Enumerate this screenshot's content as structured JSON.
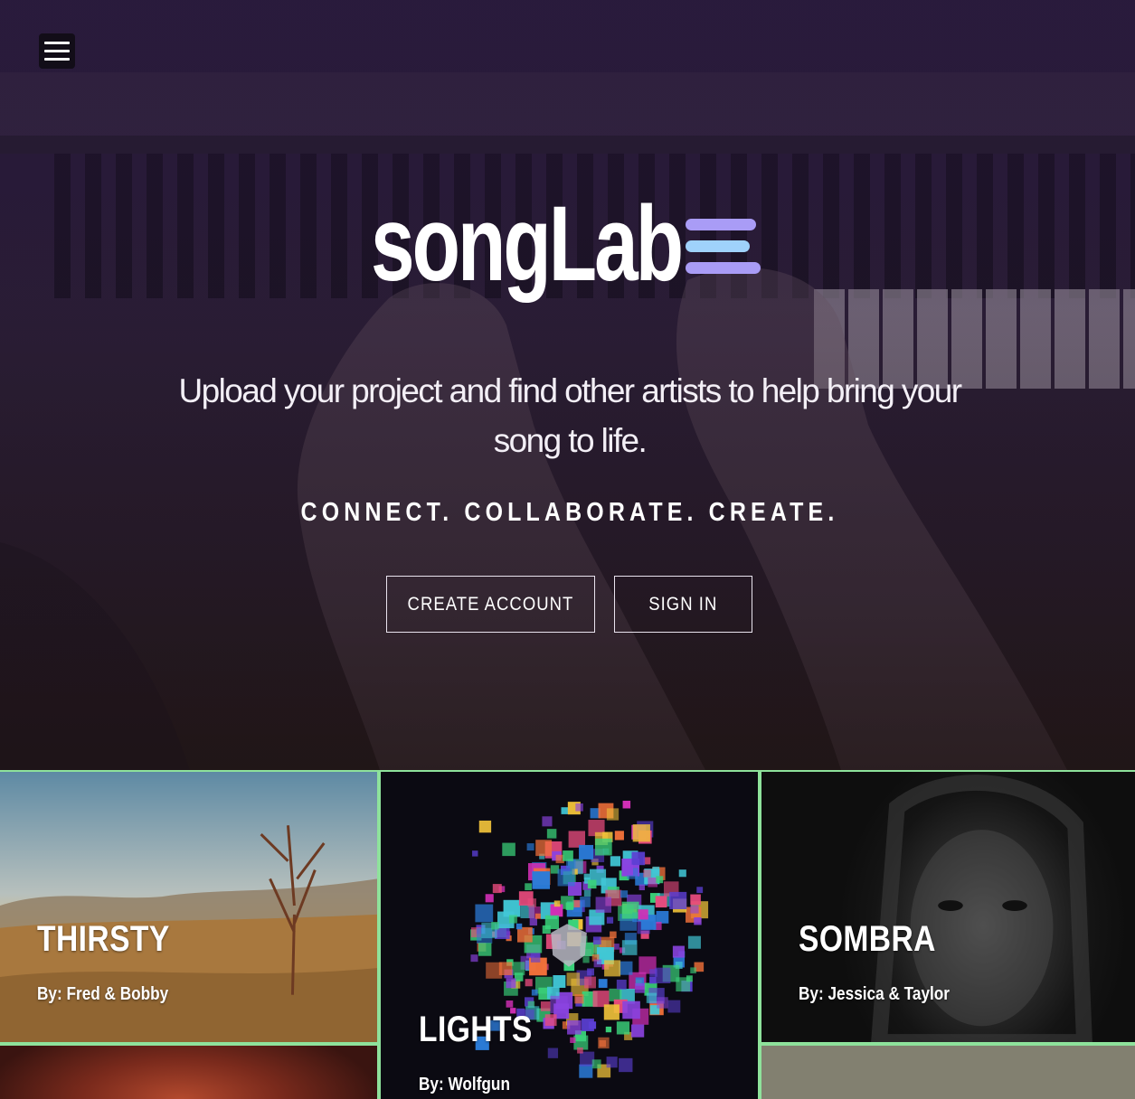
{
  "header": {
    "menu_icon": "hamburger-menu-icon"
  },
  "hero": {
    "logo_text": "songLab",
    "logo_mark_icon": "three-bars-logo-icon",
    "tagline": "Upload your project and find other artists to help bring your song to life.",
    "slogan": "CONNECT. COLLABORATE. CREATE.",
    "create_account_label": "CREATE ACCOUNT",
    "sign_in_label": "SIGN IN"
  },
  "projects": [
    {
      "title": "THIRSTY",
      "by": "By: Fred & Bobby"
    },
    {
      "title": "LIGHTS",
      "by": "By: Wolfgun"
    },
    {
      "title": "SOMBRA",
      "by": "By: Jessica & Taylor"
    }
  ],
  "colors": {
    "accent_purple": "#a99cf6",
    "accent_blue": "#9fd2fb",
    "card_border": "#8ee29b",
    "hero_bg": "#2a1b3c"
  }
}
